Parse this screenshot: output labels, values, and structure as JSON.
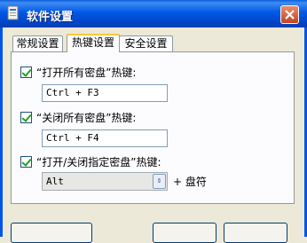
{
  "window": {
    "title": "软件设置",
    "icon": "app-window-icon",
    "close_label": "×"
  },
  "tabs": [
    {
      "label": "常规设置",
      "active": false
    },
    {
      "label": "热键设置",
      "active": true
    },
    {
      "label": "安全设置",
      "active": false
    }
  ],
  "hotkeys": [
    {
      "checked": true,
      "label": "“打开所有密盘”热键:",
      "value": "Ctrl + F3"
    },
    {
      "checked": true,
      "label": "“关闭所有密盘”热键:",
      "value": "Ctrl + F4"
    },
    {
      "checked": true,
      "label": "“打开/关闭指定密盘”热键:",
      "value": "Alt",
      "suffix": "+ 盘符",
      "control": "dropdown"
    }
  ],
  "colors": {
    "titlebar": "#0058e6",
    "tab_highlight": "#ffc83c",
    "checkmark": "#21a121"
  }
}
